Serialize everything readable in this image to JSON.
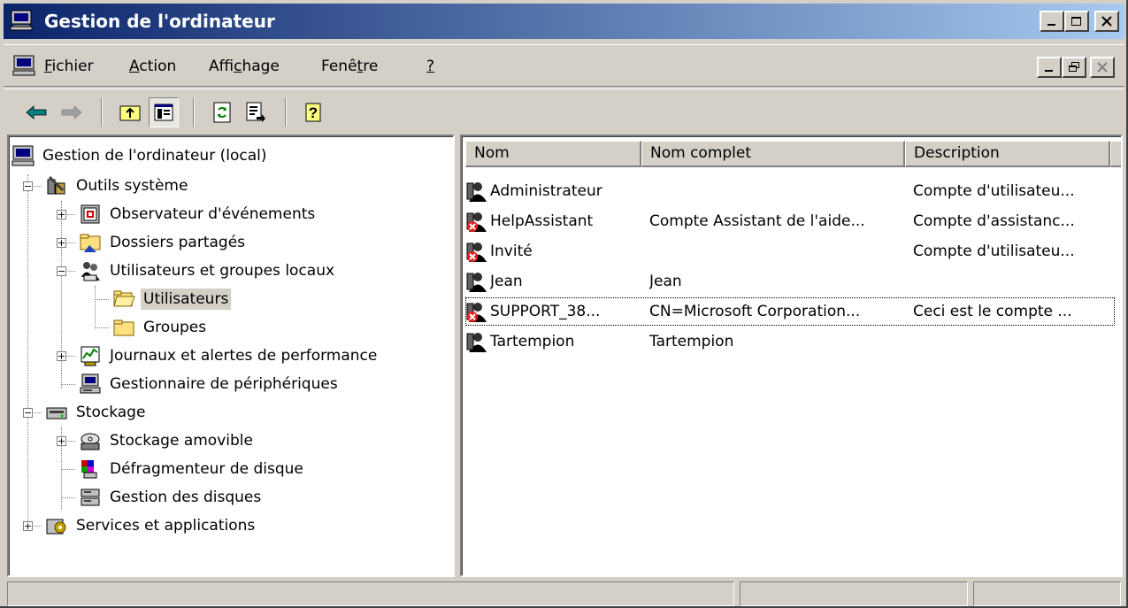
{
  "window": {
    "title": "Gestion de l'ordinateur",
    "minimize_label": "_",
    "maximize_label": "□",
    "close_label": "×"
  },
  "menu": {
    "items": [
      {
        "label_pre": "",
        "accel": "F",
        "label_post": "ichier"
      },
      {
        "label_pre": "",
        "accel": "A",
        "label_post": "ction"
      },
      {
        "label_pre": "Affi",
        "accel": "c",
        "label_post": "hage"
      },
      {
        "label_pre": "Fenê",
        "accel": "t",
        "label_post": "re"
      },
      {
        "label_pre": "",
        "accel": "?",
        "label_post": ""
      }
    ]
  },
  "toolbar": {
    "buttons": [
      "back-icon",
      "forward-icon",
      "up-folder-icon",
      "show-hide-tree-icon",
      "refresh-icon",
      "export-list-icon",
      "help-icon"
    ]
  },
  "tree": {
    "root": "Gestion de l'ordinateur (local)",
    "nodes": [
      {
        "label": "Outils système",
        "icon": "tools-icon"
      },
      {
        "label": "Observateur d'événements",
        "icon": "event-viewer-icon"
      },
      {
        "label": "Dossiers partagés",
        "icon": "shared-folders-icon"
      },
      {
        "label": "Utilisateurs et groupes locaux",
        "icon": "users-groups-icon"
      },
      {
        "label": "Utilisateurs",
        "icon": "folder-open-icon",
        "selected": true
      },
      {
        "label": "Groupes",
        "icon": "folder-icon"
      },
      {
        "label": "Journaux et alertes de performance",
        "icon": "performance-icon"
      },
      {
        "label": "Gestionnaire de périphériques",
        "icon": "device-manager-icon"
      },
      {
        "label": "Stockage",
        "icon": "storage-icon"
      },
      {
        "label": "Stockage amovible",
        "icon": "removable-storage-icon"
      },
      {
        "label": "Défragmenteur de disque",
        "icon": "defrag-icon"
      },
      {
        "label": "Gestion des disques",
        "icon": "disk-management-icon"
      },
      {
        "label": "Services et applications",
        "icon": "services-icon"
      }
    ]
  },
  "list": {
    "columns": [
      "Nom",
      "Nom complet",
      "Description"
    ],
    "rows": [
      {
        "name": "Administrateur",
        "full_name": "",
        "description": "Compte d'utilisateu...",
        "disabled": false
      },
      {
        "name": "HelpAssistant",
        "full_name": "Compte Assistant de l'aide...",
        "description": "Compte d'assistanc...",
        "disabled": true
      },
      {
        "name": "Invité",
        "full_name": "",
        "description": "Compte d'utilisateu...",
        "disabled": true
      },
      {
        "name": "Jean",
        "full_name": "Jean",
        "description": "",
        "disabled": false
      },
      {
        "name": "SUPPORT_38...",
        "full_name": "CN=Microsoft Corporation...",
        "description": "Ceci est le compte ...",
        "disabled": true,
        "focused": true
      },
      {
        "name": "Tartempion",
        "full_name": "Tartempion",
        "description": "",
        "disabled": false
      }
    ]
  },
  "colors": {
    "title_start": "#0a246a",
    "title_end": "#a6caf0",
    "face": "#d4d0c8",
    "disabled_badge": "#e02020"
  }
}
